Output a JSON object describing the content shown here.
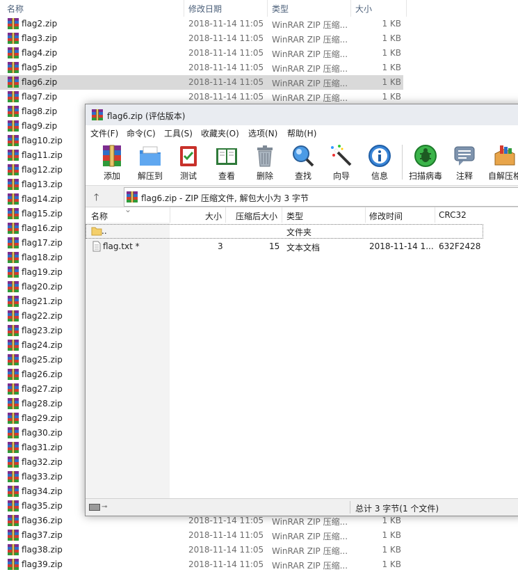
{
  "explorer": {
    "headers": {
      "name": "名称",
      "date": "修改日期",
      "type": "类型",
      "size": "大小"
    },
    "rows": [
      {
        "name": "flag2.zip",
        "date": "2018-11-14 11:05",
        "type": "WinRAR ZIP 压缩...",
        "size": "1 KB"
      },
      {
        "name": "flag3.zip",
        "date": "2018-11-14 11:05",
        "type": "WinRAR ZIP 压缩...",
        "size": "1 KB"
      },
      {
        "name": "flag4.zip",
        "date": "2018-11-14 11:05",
        "type": "WinRAR ZIP 压缩...",
        "size": "1 KB"
      },
      {
        "name": "flag5.zip",
        "date": "2018-11-14 11:05",
        "type": "WinRAR ZIP 压缩...",
        "size": "1 KB"
      },
      {
        "name": "flag6.zip",
        "date": "2018-11-14 11:05",
        "type": "WinRAR ZIP 压缩...",
        "size": "1 KB",
        "selected": true
      },
      {
        "name": "flag7.zip",
        "date": "2018-11-14 11:05",
        "type": "WinRAR ZIP 压缩...",
        "size": "1 KB"
      },
      {
        "name": "flag8.zip"
      },
      {
        "name": "flag9.zip"
      },
      {
        "name": "flag10.zip"
      },
      {
        "name": "flag11.zip"
      },
      {
        "name": "flag12.zip"
      },
      {
        "name": "flag13.zip"
      },
      {
        "name": "flag14.zip"
      },
      {
        "name": "flag15.zip"
      },
      {
        "name": "flag16.zip"
      },
      {
        "name": "flag17.zip"
      },
      {
        "name": "flag18.zip"
      },
      {
        "name": "flag19.zip"
      },
      {
        "name": "flag20.zip"
      },
      {
        "name": "flag21.zip"
      },
      {
        "name": "flag22.zip"
      },
      {
        "name": "flag23.zip"
      },
      {
        "name": "flag24.zip"
      },
      {
        "name": "flag25.zip"
      },
      {
        "name": "flag26.zip"
      },
      {
        "name": "flag27.zip"
      },
      {
        "name": "flag28.zip"
      },
      {
        "name": "flag29.zip"
      },
      {
        "name": "flag30.zip"
      },
      {
        "name": "flag31.zip"
      },
      {
        "name": "flag32.zip"
      },
      {
        "name": "flag33.zip"
      },
      {
        "name": "flag34.zip"
      },
      {
        "name": "flag35.zip"
      },
      {
        "name": "flag36.zip",
        "date": "2018-11-14 11:05",
        "type": "WinRAR ZIP 压缩...",
        "size": "1 KB"
      },
      {
        "name": "flag37.zip",
        "date": "2018-11-14 11:05",
        "type": "WinRAR ZIP 压缩...",
        "size": "1 KB"
      },
      {
        "name": "flag38.zip",
        "date": "2018-11-14 11:05",
        "type": "WinRAR ZIP 压缩...",
        "size": "1 KB"
      },
      {
        "name": "flag39.zip",
        "date": "2018-11-14 11:05",
        "type": "WinRAR ZIP 压缩...",
        "size": "1 KB"
      }
    ]
  },
  "winrar": {
    "title": "flag6.zip (评估版本)",
    "menu": [
      "文件(F)",
      "命令(C)",
      "工具(S)",
      "收藏夹(O)",
      "选项(N)",
      "帮助(H)"
    ],
    "toolbar": [
      {
        "label": "添加",
        "icon": "add-archive-icon"
      },
      {
        "label": "解压到",
        "icon": "extract-folder-icon"
      },
      {
        "label": "测试",
        "icon": "test-checklist-icon"
      },
      {
        "label": "查看",
        "icon": "view-book-icon"
      },
      {
        "label": "删除",
        "icon": "trash-icon"
      },
      {
        "label": "查找",
        "icon": "magnifier-icon"
      },
      {
        "label": "向导",
        "icon": "wizard-wand-icon"
      },
      {
        "label": "信息",
        "icon": "info-icon"
      },
      {
        "label": "扫描病毒",
        "icon": "virus-scan-icon"
      },
      {
        "label": "注释",
        "icon": "comment-icon"
      },
      {
        "label": "自解压格",
        "icon": "sfx-box-icon"
      }
    ],
    "address": "flag6.zip - ZIP 压缩文件, 解包大小为 3 字节",
    "columns": {
      "name": "名称",
      "size": "大小",
      "packed": "压缩后大小",
      "type": "类型",
      "modified": "修改时间",
      "crc": "CRC32"
    },
    "files": [
      {
        "name": "..",
        "size": "",
        "packed": "",
        "type": "文件夹",
        "modified": "",
        "crc": ""
      },
      {
        "name": "flag.txt *",
        "size": "3",
        "packed": "15",
        "type": "文本文档",
        "modified": "2018-11-14 1...",
        "crc": "632F2428"
      }
    ],
    "status": "总计 3 字节(1 个文件)"
  }
}
